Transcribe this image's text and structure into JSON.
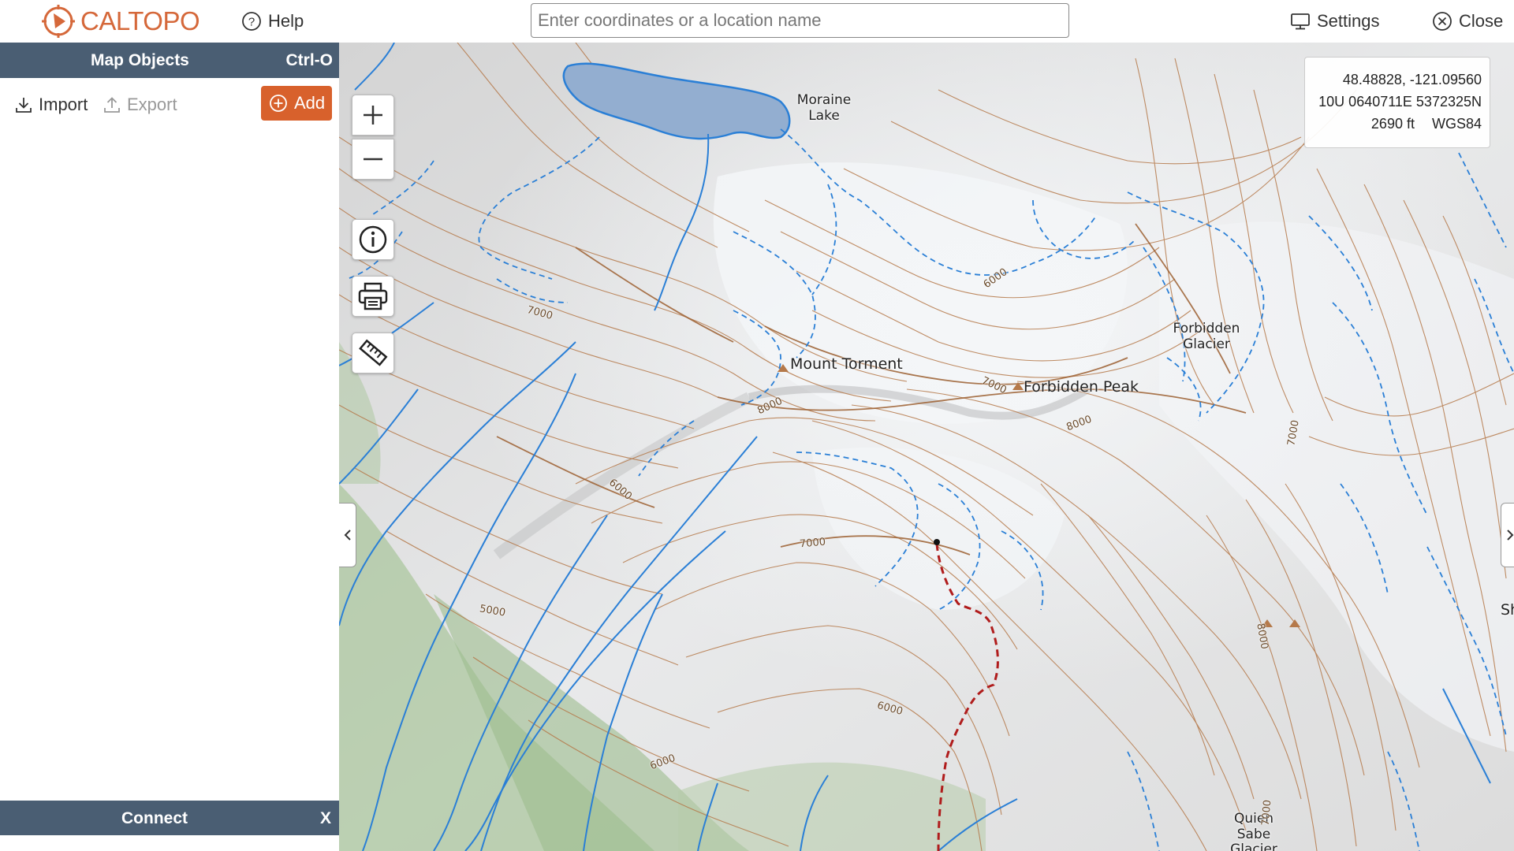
{
  "app": {
    "logo_text": "CALTOPO"
  },
  "header": {
    "help_label": "Help",
    "search_placeholder": "Enter coordinates or a location name",
    "settings_label": "Settings",
    "close_label": "Close"
  },
  "left_panel": {
    "title": "Map Objects",
    "shortcut": "Ctrl-O",
    "import_label": "Import",
    "export_label": "Export",
    "add_label": "Add",
    "connect_label": "Connect",
    "connect_close": "X"
  },
  "map": {
    "coords": {
      "latlon": "48.48828, -121.09560",
      "utm": "10U 0640711E 5372325N",
      "elevation": "2690 ft",
      "datum": "WGS84"
    },
    "labels": {
      "moraine_lake_1": "Moraine",
      "moraine_lake_2": "Lake",
      "forbidden_glacier_1": "Forbidden",
      "forbidden_glacier_2": "Glacier",
      "mount_torment": "Mount Torment",
      "forbidden_peak": "Forbidden Peak",
      "quien_sabe_1": "Quien",
      "quien_sabe_2": "Sabe",
      "quien_sabe_3": "Glacier",
      "sharkfin_partial": "Sha"
    },
    "contour_labels": [
      "7000",
      "6000",
      "7000",
      "8000",
      "8000",
      "6000",
      "5000",
      "7000",
      "6000",
      "6000",
      "7000",
      "8000",
      "7000"
    ],
    "colors": {
      "water": "#93aed0",
      "stream": "#2a7fd6",
      "contour": "#b5794a",
      "trail": "#b01c1c",
      "panel_header": "#4a5e73",
      "accent": "#d8612c"
    }
  }
}
